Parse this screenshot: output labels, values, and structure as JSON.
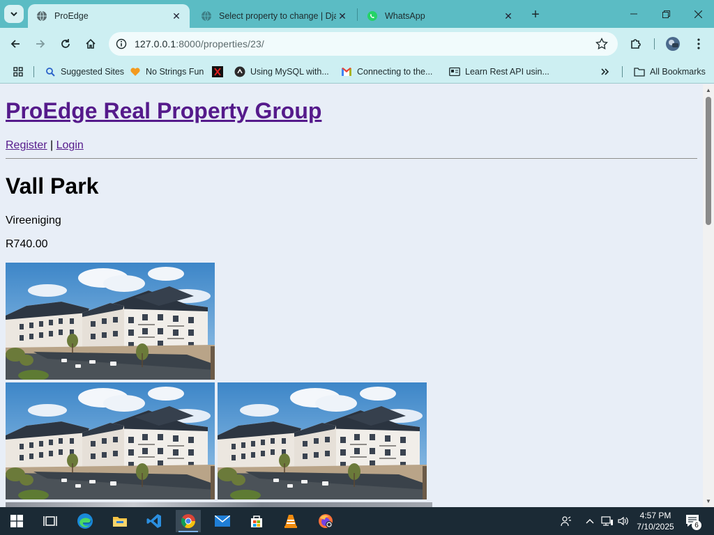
{
  "browser": {
    "tabs": [
      {
        "title": "ProEdge",
        "active": true,
        "favicon": "globe-icon"
      },
      {
        "title": "Select property to change | Dja",
        "active": false,
        "favicon": "globe-icon"
      },
      {
        "title": "WhatsApp",
        "active": false,
        "favicon": "whatsapp-icon"
      }
    ],
    "url_host": "127.0.0.1",
    "url_rest": ":8000/properties/23/",
    "bookmarks": [
      {
        "label": "Suggested Sites",
        "icon": "search-icon"
      },
      {
        "label": "No Strings Fun",
        "icon": "heart-icon"
      },
      {
        "label": "",
        "icon": "x-icon"
      },
      {
        "label": "Using MySQL with...",
        "icon": "mysql-icon"
      },
      {
        "label": "Connecting to the...",
        "icon": "gmail-icon"
      },
      {
        "label": "Learn Rest API usin...",
        "icon": "card-icon"
      }
    ],
    "all_bookmarks": "All Bookmarks"
  },
  "page": {
    "site_title": "ProEdge Real Property Group",
    "nav": {
      "register": "Register",
      "separator": " | ",
      "login": "Login"
    },
    "property": {
      "name": "Vall Park",
      "location": "Vireeniging",
      "price": "R740.00"
    }
  },
  "taskbar": {
    "time": "4:57 PM",
    "date": "7/10/2025",
    "notification_count": "6"
  },
  "colors": {
    "tabstrip": "#5bbcc4",
    "toolbar": "#cdeff2",
    "page_bg": "#e8eef7",
    "link_visited": "#551a8b",
    "taskbar": "#1b2a35"
  }
}
